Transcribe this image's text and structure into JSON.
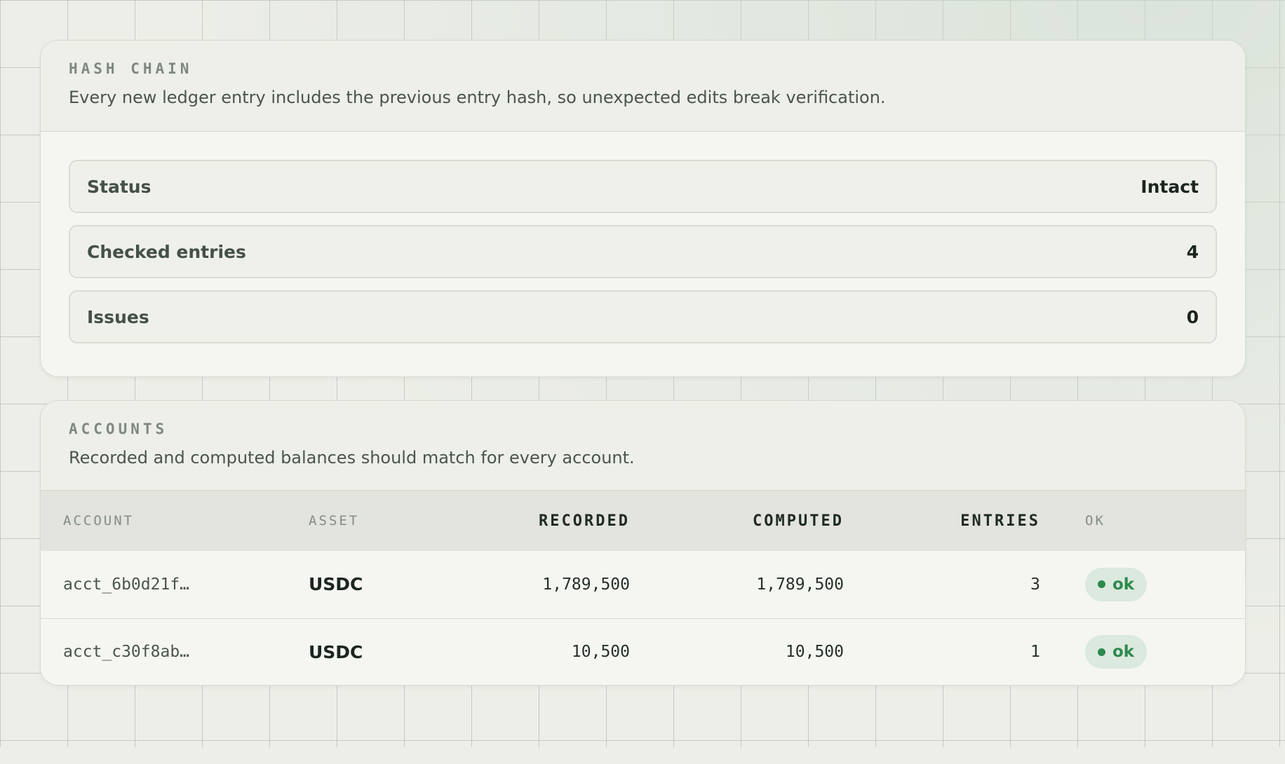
{
  "hash_chain": {
    "eyebrow": "HASH CHAIN",
    "description": "Every new ledger entry includes the previous entry hash, so unexpected edits break verification.",
    "stats": [
      {
        "label": "Status",
        "value": "Intact"
      },
      {
        "label": "Checked entries",
        "value": "4"
      },
      {
        "label": "Issues",
        "value": "0"
      }
    ]
  },
  "accounts": {
    "eyebrow": "ACCOUNTS",
    "description": "Recorded and computed balances should match for every account.",
    "columns": {
      "account": "ACCOUNT",
      "asset": "ASSET",
      "recorded": "RECORDED",
      "computed": "COMPUTED",
      "entries": "ENTRIES",
      "ok": "OK"
    },
    "rows": [
      {
        "account": "acct_6b0d21f…",
        "asset": "USDC",
        "recorded": "1,789,500",
        "computed": "1,789,500",
        "entries": "3",
        "ok": "ok"
      },
      {
        "account": "acct_c30f8ab…",
        "asset": "USDC",
        "recorded": "10,500",
        "computed": "10,500",
        "entries": "1",
        "ok": "ok"
      }
    ]
  },
  "colors": {
    "accent_ok": "#2e8a4e",
    "badge_bg": "#dce9de",
    "page_bg": "#eceee7"
  }
}
